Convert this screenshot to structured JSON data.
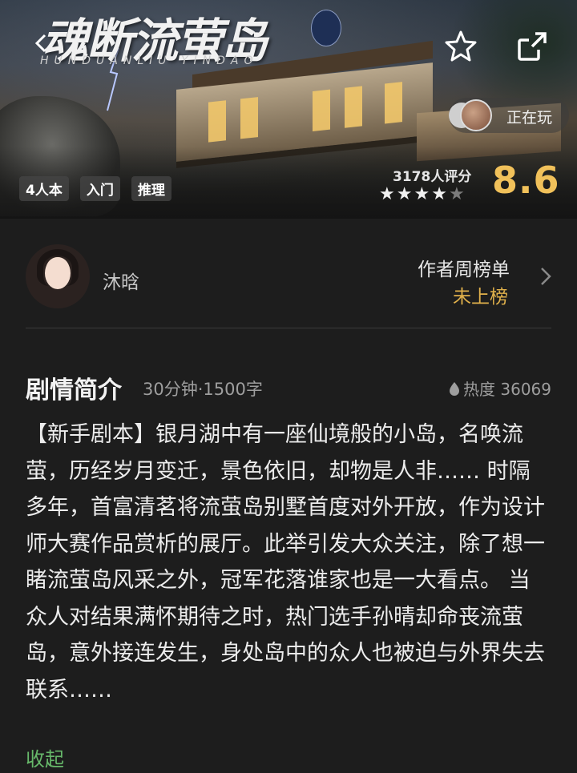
{
  "hero": {
    "title": "魂断流萤岛",
    "title_pinyin": "HUNDUANLIU   YINDAO",
    "tags": [
      "4人本",
      "入门",
      "推理"
    ],
    "playing_label": "正在玩",
    "rating_count": "3178人评分",
    "score": "8.6",
    "stars_filled": 4,
    "stars_total": 5
  },
  "author": {
    "name": "沐晗",
    "rank_label": "作者周榜单",
    "rank_value": "未上榜"
  },
  "synopsis": {
    "title": "剧情简介",
    "meta": "30分钟·1500字",
    "heat": "热度 36069",
    "body": "【新手剧本】银月湖中有一座仙境般的小岛，名唤流萤，历经岁月变迁，景色依旧，却物是人非…… 时隔多年，首富清茗将流萤岛别墅首度对外开放，作为设计师大赛作品赏析的展厅。此举引发大众关注，除了想一睹流萤岛风采之外，冠军花落谁家也是一大看点。 当众人对结果满怀期待之时，热门选手孙晴却命丧流萤岛，意外接连发生，身处岛中的众人也被迫与外界失去联系……",
    "collapse_label": "收起"
  },
  "colors": {
    "background": "#1d1d1d",
    "score": "#f1c15a",
    "rank_value": "#e1b14b",
    "collapse": "#67b86a"
  }
}
